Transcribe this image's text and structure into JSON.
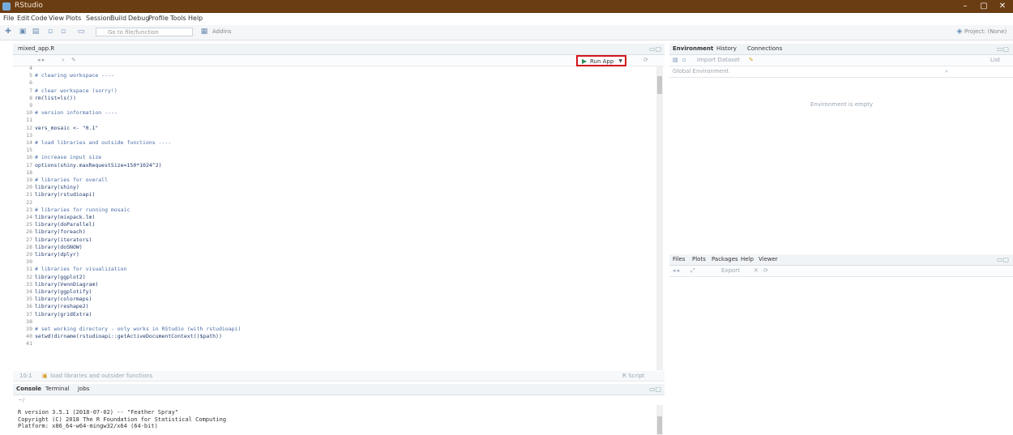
{
  "window": {
    "title": "RStudio",
    "controls": [
      "–",
      "▢",
      "✕"
    ]
  },
  "menu": [
    "File",
    "Edit",
    "Code",
    "View",
    "Plots",
    "Session",
    "Build",
    "Debug",
    "Profile",
    "Tools",
    "Help"
  ],
  "toolbar": {
    "goto_placeholder": "Go to file/function",
    "addins_label": "Addins",
    "project_label": "Project: (None)"
  },
  "editor": {
    "tab_label": "mixed_app.R",
    "run_app_label": "Run App",
    "status_left": "10:1",
    "status_section": "load libraries and outsider functions",
    "status_right": "R Script",
    "lines": [
      {
        "n": "4",
        "t": ""
      },
      {
        "n": "5",
        "t": "# clearing workspace ----",
        "k": "section"
      },
      {
        "n": "6",
        "t": ""
      },
      {
        "n": "7",
        "t": "# clear workspace (sorry!)",
        "k": "comment"
      },
      {
        "n": "8",
        "t": "rm(list=ls())"
      },
      {
        "n": "9",
        "t": ""
      },
      {
        "n": "10",
        "t": "# version information ----",
        "k": "section"
      },
      {
        "n": "11",
        "t": ""
      },
      {
        "n": "12",
        "t": "vers_mosaic <- \"0.1\""
      },
      {
        "n": "13",
        "t": ""
      },
      {
        "n": "14",
        "t": "# load libraries and outside functions ----",
        "k": "section"
      },
      {
        "n": "15",
        "t": ""
      },
      {
        "n": "16",
        "t": "# increase input size",
        "k": "comment"
      },
      {
        "n": "17",
        "t": "options(shiny.maxRequestSize=150*1024^2)"
      },
      {
        "n": "18",
        "t": ""
      },
      {
        "n": "19",
        "t": "# libraries for overall",
        "k": "comment"
      },
      {
        "n": "20",
        "t": "library(shiny)"
      },
      {
        "n": "21",
        "t": "library(rstudioapi)"
      },
      {
        "n": "22",
        "t": ""
      },
      {
        "n": "23",
        "t": "# libraries for running mosaic",
        "k": "comment"
      },
      {
        "n": "24",
        "t": "library(mixpack.lm)"
      },
      {
        "n": "25",
        "t": "library(doParallel)"
      },
      {
        "n": "26",
        "t": "library(foreach)"
      },
      {
        "n": "27",
        "t": "library(iterators)"
      },
      {
        "n": "28",
        "t": "library(doSNOW)"
      },
      {
        "n": "29",
        "t": "library(dplyr)"
      },
      {
        "n": "30",
        "t": ""
      },
      {
        "n": "31",
        "t": "# libraries for visualization",
        "k": "comment"
      },
      {
        "n": "32",
        "t": "library(ggplot2)"
      },
      {
        "n": "33",
        "t": "library(VennDiagram)"
      },
      {
        "n": "34",
        "t": "library(ggplotify)"
      },
      {
        "n": "35",
        "t": "library(colormaps)"
      },
      {
        "n": "36",
        "t": "library(reshape2)"
      },
      {
        "n": "37",
        "t": "library(gridExtra)"
      },
      {
        "n": "38",
        "t": ""
      },
      {
        "n": "39",
        "t": "# set working directory - only works in RStudio (with rstudioapi)",
        "k": "comment"
      },
      {
        "n": "40",
        "t": "setwd(dirname(rstudioapi::getActiveDocumentContext()$path))"
      },
      {
        "n": "41",
        "t": ""
      }
    ]
  },
  "console": {
    "tabs": [
      "Console",
      "Terminal",
      "Jobs"
    ],
    "path": "~/",
    "lines": [
      "R version 3.5.1 (2018-07-02) -- \"Feather Spray\"",
      "Copyright (C) 2018 The R Foundation for Statistical Computing",
      "Platform: x86_64-w64-mingw32/x64 (64-bit)"
    ]
  },
  "environment": {
    "tabs": [
      "Environment",
      "History",
      "Connections"
    ],
    "import_label": "Import Dataset",
    "scope_label": "Global Environment",
    "list_label": "List",
    "empty_message": "Environment is empty"
  },
  "files": {
    "tabs": [
      "Files",
      "Plots",
      "Packages",
      "Help",
      "Viewer"
    ],
    "export_label": "Export"
  },
  "colors": {
    "titlebar": "#6b3d12",
    "highlight": "#d4161e",
    "run": "#2e8b57"
  }
}
